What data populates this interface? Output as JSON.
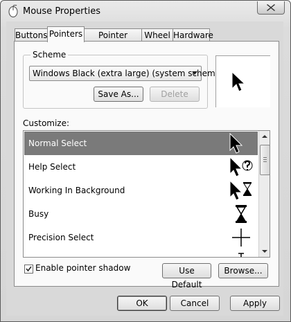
{
  "window": {
    "title": "Mouse Properties"
  },
  "tabs": [
    {
      "label": "Buttons"
    },
    {
      "label": "Pointers"
    },
    {
      "label": "Pointer Options"
    },
    {
      "label": "Wheel"
    },
    {
      "label": "Hardware"
    }
  ],
  "active_tab": "Pointers",
  "scheme": {
    "group_label": "Scheme",
    "selected": "Windows Black (extra large) (system scheme)",
    "save_as_label": "Save As...",
    "delete_label": "Delete"
  },
  "customize": {
    "label": "Customize:",
    "items": [
      {
        "label": "Normal Select",
        "cursor": "arrow-icon",
        "selected": true
      },
      {
        "label": "Help Select",
        "cursor": "help-select-icon"
      },
      {
        "label": "Working In Background",
        "cursor": "working-in-background-icon"
      },
      {
        "label": "Busy",
        "cursor": "hourglass-icon"
      },
      {
        "label": "Precision Select",
        "cursor": "crosshair-icon"
      }
    ]
  },
  "shadow": {
    "label": "Enable pointer shadow",
    "checked": true
  },
  "buttons": {
    "use_default": "Use Default",
    "browse": "Browse...",
    "ok": "OK",
    "cancel": "Cancel",
    "apply": "Apply"
  }
}
